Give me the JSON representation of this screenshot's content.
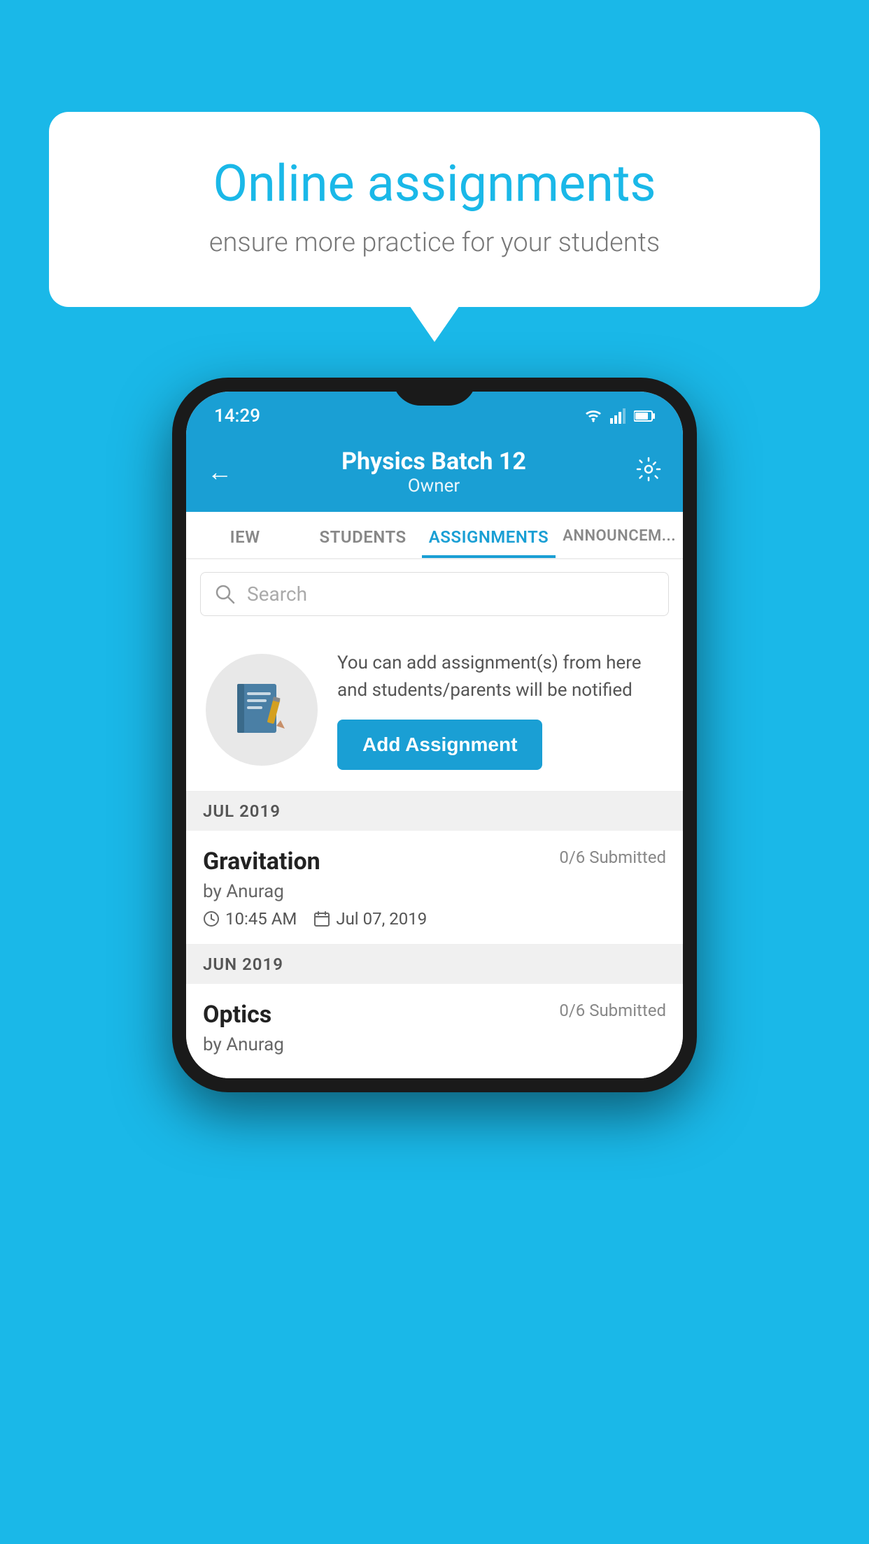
{
  "background_color": "#1ab8e8",
  "speech_bubble": {
    "title": "Online assignments",
    "subtitle": "ensure more practice for your students"
  },
  "status_bar": {
    "time": "14:29",
    "wifi_icon": "wifi",
    "signal_icon": "signal",
    "battery_icon": "battery"
  },
  "header": {
    "title": "Physics Batch 12",
    "subtitle": "Owner",
    "back_label": "←",
    "settings_label": "⚙"
  },
  "tabs": [
    {
      "label": "IEW",
      "active": false
    },
    {
      "label": "STUDENTS",
      "active": false
    },
    {
      "label": "ASSIGNMENTS",
      "active": true
    },
    {
      "label": "ANNOUNCEM...",
      "active": false
    }
  ],
  "search": {
    "placeholder": "Search"
  },
  "promo": {
    "text": "You can add assignment(s) from here and students/parents will be notified",
    "button_label": "Add Assignment"
  },
  "sections": [
    {
      "label": "JUL 2019",
      "assignments": [
        {
          "name": "Gravitation",
          "submitted": "0/6 Submitted",
          "author": "by Anurag",
          "time": "10:45 AM",
          "date": "Jul 07, 2019"
        }
      ]
    },
    {
      "label": "JUN 2019",
      "assignments": [
        {
          "name": "Optics",
          "submitted": "0/6 Submitted",
          "author": "by Anurag",
          "time": "",
          "date": ""
        }
      ]
    }
  ]
}
